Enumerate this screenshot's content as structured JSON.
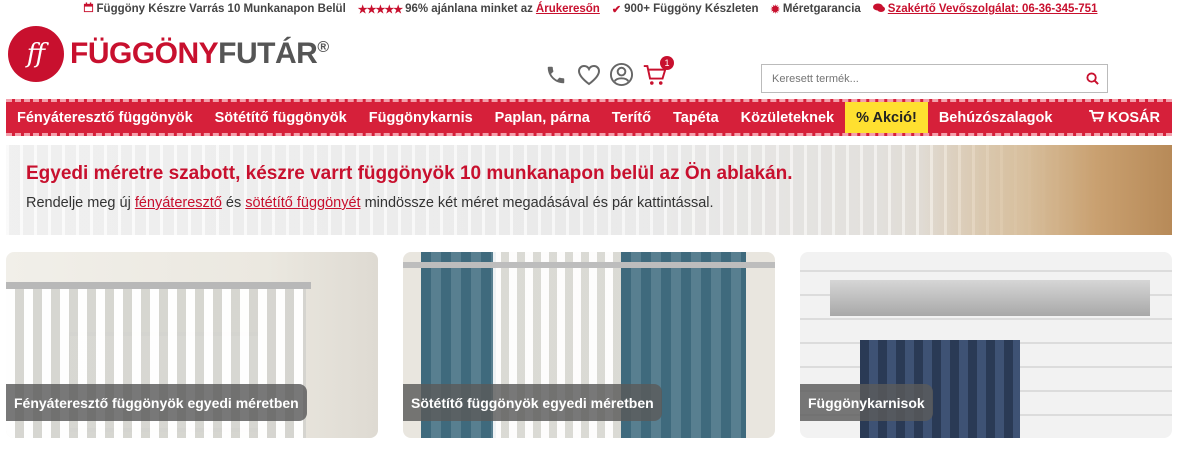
{
  "topbar": {
    "item1": "Függöny Készre Varrás 10 Munkanapon Belül",
    "item2_pre": "96% ajánlana minket az ",
    "item2_link": "Árukeresőn",
    "item3": "900+ Függöny Készleten",
    "item4": "Méretgarancia",
    "item5_label": "Szakértő Vevőszolgálat: ",
    "item5_phone": "06-36-345-751",
    "colors": {
      "accent": "#c8102e"
    }
  },
  "logo": {
    "part1": "FÜGGÖNY",
    "part2": "FUTÁR",
    "reg": "®",
    "monogram": "ff"
  },
  "header_icons": {
    "phone": "phone-icon",
    "heart": "heart-icon",
    "user": "user-icon",
    "cart": "cart-icon",
    "cart_count": "1"
  },
  "search": {
    "placeholder": "Keresett termék..."
  },
  "nav": {
    "items": [
      "Fényáteresztő függönyök",
      "Sötétítő függönyök",
      "Függönykarnis",
      "Paplan, párna",
      "Terítő",
      "Tapéta",
      "Közületeknek",
      "% Akció!",
      "Behúzószalagok"
    ],
    "cart": "KOSÁR"
  },
  "banner": {
    "title": "Egyedi méretre szabott, készre varrt függönyök 10 munkanapon belül az Ön ablakán.",
    "text_pre": "Rendelje meg új ",
    "link1": "fényáteresztő",
    "text_mid": " és ",
    "link2": "sötétítő függönyét",
    "text_post": " mindössze két méret megadásával és pár kattintással."
  },
  "cards": [
    {
      "label": "Fényáteresztő függönyök egyedi méretben"
    },
    {
      "label": "Sötétítő függönyök egyedi méretben"
    },
    {
      "label": "Függönykarnisok"
    }
  ]
}
